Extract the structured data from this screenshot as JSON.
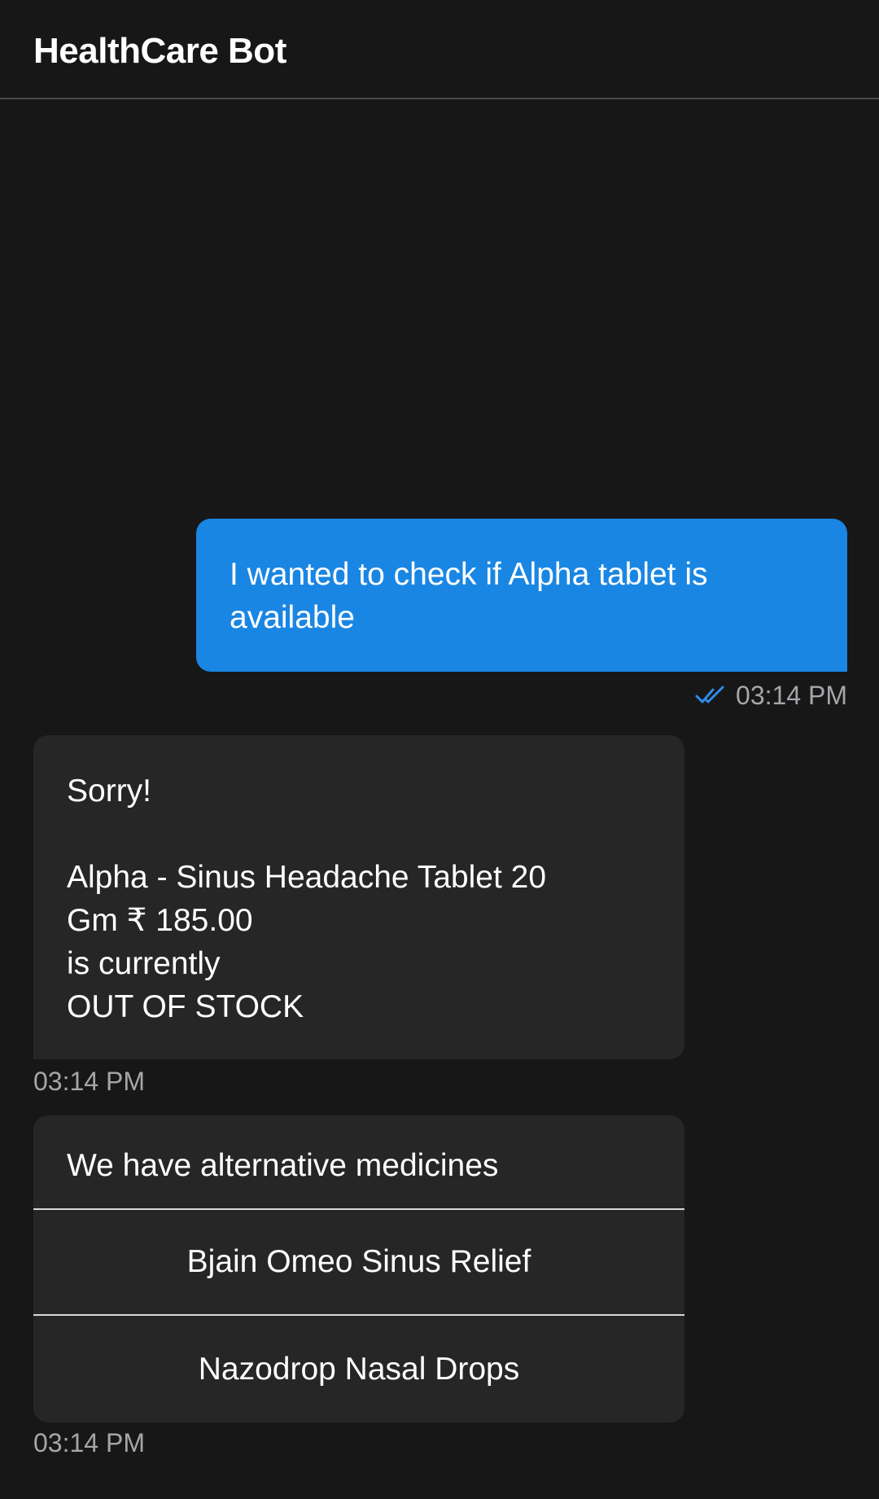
{
  "header": {
    "title": "HealthCare Bot"
  },
  "messages": {
    "user": {
      "text": "I wanted to check if Alpha tablet is available",
      "time": "03:14 PM"
    },
    "bot": {
      "line1": "Sorry!",
      "line2": "Alpha - Sinus Headache Tablet 20",
      "line3": "Gm ₹ 185.00",
      "line4": "is currently",
      "line5": "OUT OF STOCK",
      "time": "03:14 PM"
    },
    "alternatives": {
      "prompt": "We have alternative medicines",
      "options": [
        {
          "label": "Bjain Omeo Sinus Relief"
        },
        {
          "label": "Nazodrop Nasal Drops"
        }
      ],
      "time": "03:14 PM"
    }
  },
  "colors": {
    "background": "#171718",
    "user_bubble": "#1a86e3",
    "bot_bubble": "#262627",
    "meta_text": "#a6a6aa",
    "read_check": "#2e8ce6"
  },
  "icons": {
    "read_receipt": "double-check-icon"
  }
}
